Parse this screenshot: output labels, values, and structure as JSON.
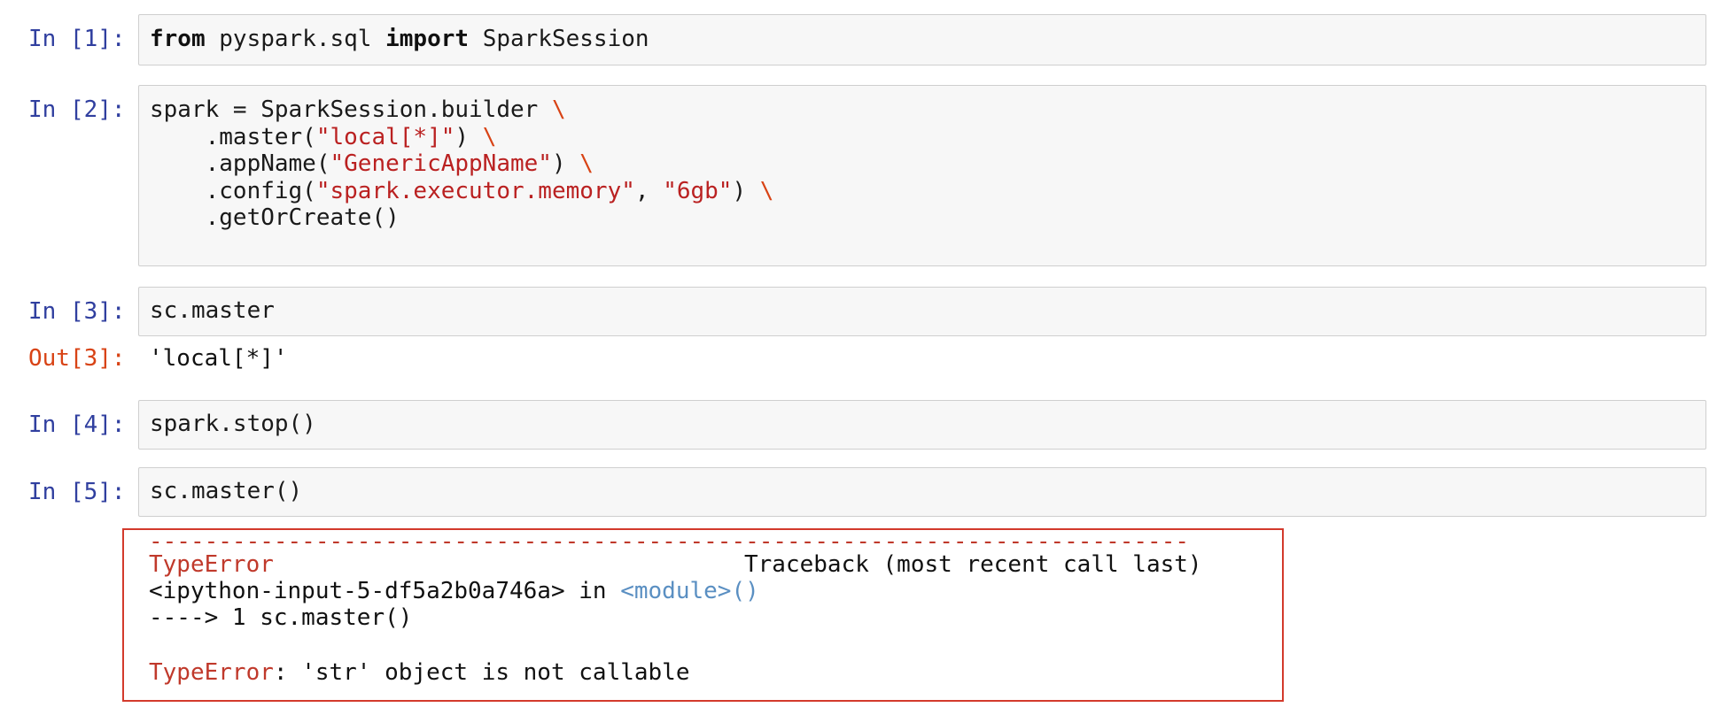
{
  "cells": [
    {
      "prompt": "In [1]:",
      "lines": [
        {
          "kw1": "from",
          "mid": " pyspark.sql ",
          "kw2": "import",
          "rest": " SparkSession"
        }
      ]
    },
    {
      "prompt": "In [2]:",
      "line1_code": "spark = SparkSession.builder ",
      "line1_cont": "\\",
      "line2_pre": "    .master(",
      "line2_str": "\"local[*]\"",
      "line2_post": ") ",
      "line2_cont": "\\",
      "line3_pre": "    .appName(",
      "line3_str": "\"GenericAppName\"",
      "line3_post": ") ",
      "line3_cont": "\\",
      "line4_pre": "    .config(",
      "line4_str1": "\"spark.executor.memory\"",
      "line4_mid": ", ",
      "line4_str2": "\"6gb\"",
      "line4_post": ") ",
      "line4_cont": "\\",
      "line5": "    .getOrCreate()"
    },
    {
      "prompt": "In [3]:",
      "code": "sc.master"
    },
    {
      "prompt": "In [4]:",
      "code": "spark.stop()"
    },
    {
      "prompt": "In [5]:",
      "code": "sc.master()"
    }
  ],
  "output3": {
    "prompt": "Out[3]:",
    "text": "'local[*]'"
  },
  "traceback": {
    "dashes": "---------------------------------------------------------------------------",
    "error_name": "TypeError",
    "header_right": "Traceback (most recent call last)",
    "location_pre": "<ipython-input-5-df5a2b0a746a> in ",
    "location_module": "<module>()",
    "arrow_line": "----> 1 sc.master()",
    "final_error_name": "TypeError",
    "final_message": ": 'str' object is not callable"
  }
}
